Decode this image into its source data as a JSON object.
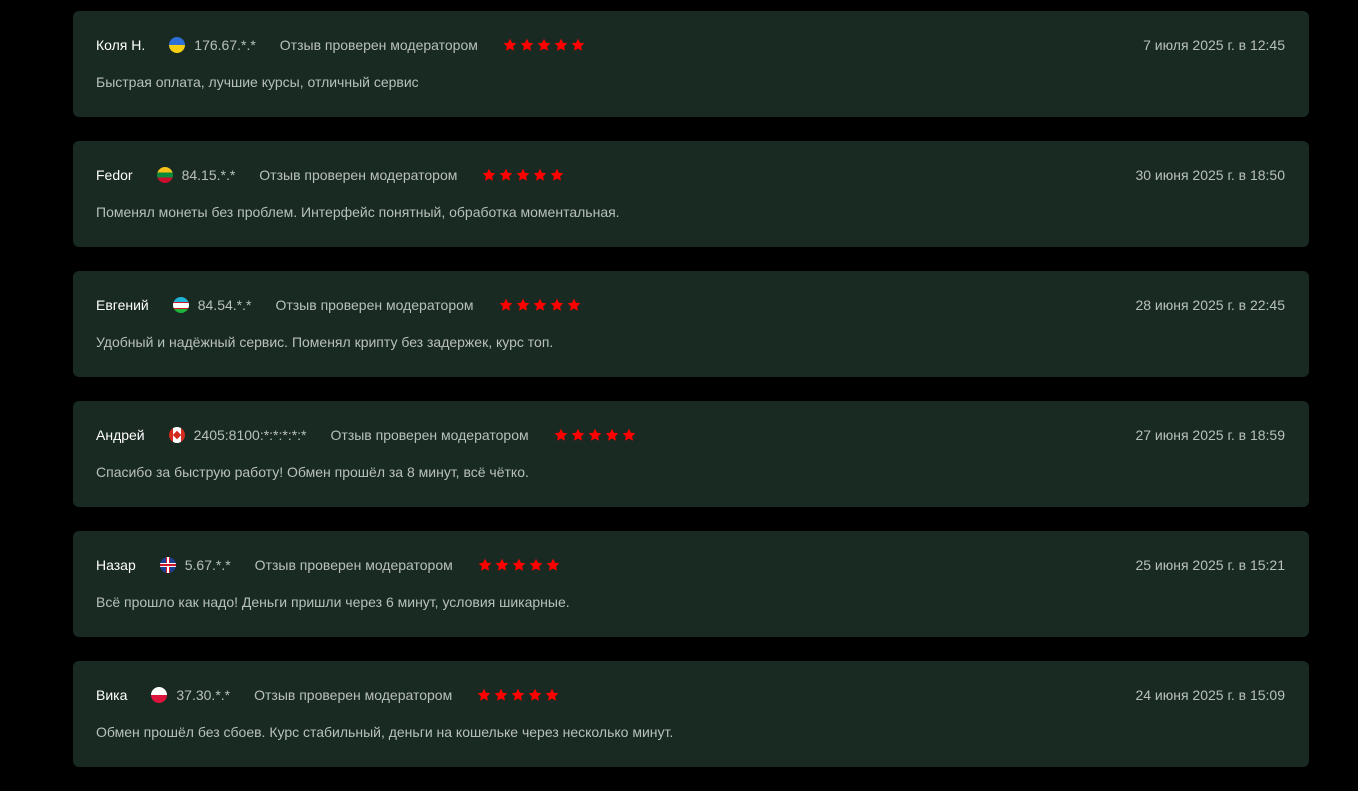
{
  "colors": {
    "page_background": "#000000",
    "card_background": "#182a22",
    "author_text": "#ffffff",
    "muted_text": "#b9c0bc",
    "star": "#ff0000"
  },
  "reviews": [
    {
      "author": "Коля Н.",
      "flag": "ua-flag-icon",
      "ip": "176.67.*.*",
      "verified": "Отзыв проверен модератором",
      "rating": 5,
      "date": "7 июля 2025 г. в 12:45",
      "text": "Быстрая оплата, лучшие курсы, отличный сервис"
    },
    {
      "author": "Fedor",
      "flag": "lt-flag-icon",
      "ip": "84.15.*.*",
      "verified": "Отзыв проверен модератором",
      "rating": 5,
      "date": "30 июня 2025 г. в 18:50",
      "text": "Поменял монеты без проблем. Интерфейс понятный, обработка моментальная."
    },
    {
      "author": "Евгений",
      "flag": "uz-flag-icon",
      "ip": "84.54.*.*",
      "verified": "Отзыв проверен модератором",
      "rating": 5,
      "date": "28 июня 2025 г. в 22:45",
      "text": "Удобный и надёжный сервис. Поменял крипту без задержек, курс топ."
    },
    {
      "author": "Андрей",
      "flag": "ca-flag-icon",
      "ip": "2405:8100:*:*:*:*:*",
      "verified": "Отзыв проверен модератором",
      "rating": 5,
      "date": "27 июня 2025 г. в 18:59",
      "text": "Спасибо за быструю работу! Обмен прошёл за 8 минут, всё чётко."
    },
    {
      "author": "Назар",
      "flag": "gb-flag-icon",
      "ip": "5.67.*.*",
      "verified": "Отзыв проверен модератором",
      "rating": 5,
      "date": "25 июня 2025 г. в 15:21",
      "text": "Всё прошло как надо! Деньги пришли через 6 минут, условия шикарные."
    },
    {
      "author": "Вика",
      "flag": "pl-flag-icon",
      "ip": "37.30.*.*",
      "verified": "Отзыв проверен модератором",
      "rating": 5,
      "date": "24 июня 2025 г. в 15:09",
      "text": "Обмен прошёл без сбоев. Курс стабильный, деньги на кошельке через несколько минут."
    }
  ]
}
